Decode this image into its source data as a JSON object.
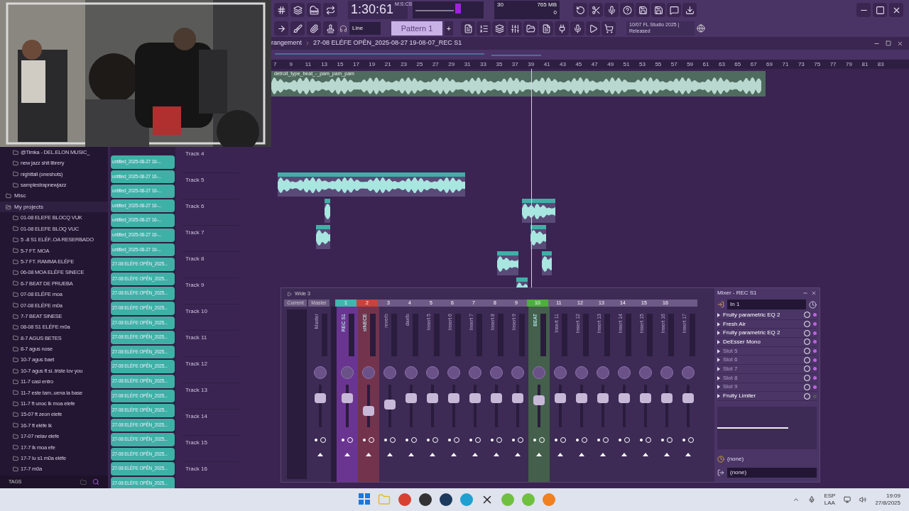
{
  "toolbar": {
    "time": "1:30:61",
    "time_unit": "M:S:CS",
    "cpu": "30",
    "memory": "765 MB",
    "voices": "0",
    "snap": "Line",
    "pattern": "Pattern 1",
    "pattern_add": "+",
    "news": "10/07  FL Studio 2025 | Released"
  },
  "breadcrumb": [
    "rangement",
    "27-08 ELÉFE OPĚN_2025-08-27 19-08-07_REC S1"
  ],
  "ruler": [
    "7",
    "9",
    "11",
    "13",
    "15",
    "17",
    "19",
    "21",
    "23",
    "25",
    "27",
    "29",
    "31",
    "33",
    "35",
    "37",
    "39",
    "41",
    "43",
    "45",
    "47",
    "49",
    "51",
    "53",
    "55",
    "57",
    "59",
    "61",
    "63",
    "65",
    "67",
    "69",
    "71",
    "73",
    "75",
    "77",
    "79",
    "81",
    "83"
  ],
  "top_clip": {
    "label": "detroit_type_beat_-_pam_pam_pam"
  },
  "sidebar": {
    "continued_children": [
      "@Timka - DEL.ELON MUSIC_",
      "new jazz shit librery",
      "nightfall (oneshots)",
      "samplestrapnewjazz"
    ],
    "items": [
      {
        "label": "Misc",
        "expanded": false,
        "selected": false
      },
      {
        "label": "My projects",
        "expanded": true,
        "selected": true,
        "children": [
          "01-08 ELEFE BLOCQ VUK",
          "01-08 ELEFE BLOQ VUC",
          "5 -8 S1 ELÉF..OA RESERBADO",
          "5-7 FT. MOA",
          "5-7 FT. RAMMA ELÉFE",
          "06-08 MOA ELÉFE SINECE",
          "6-7 BEAT DE PRUEBA",
          "07-08  ELÉFE moa",
          "07-08 ELÉFE m0a",
          "7-7 BEAT SINESE",
          "08-08 S1 ELÉFE m0a",
          "8-7 AGUS BETES",
          "8-7 agus nose",
          "10-7 agus baet",
          "10-7 agus ft si..triste lov you",
          "11-7 casi entro",
          "11-7 este tam..uena la base",
          "11-7 ft unoc lk moa elefe",
          "15-07 ft zeon elefe",
          "16-7 ft eléfe lk",
          "17-07 nelav elefe",
          "17-7 lk moa efe",
          "17-7 lu s1 m0a eléfe",
          "17-7 m0a"
        ]
      }
    ],
    "tags_label": "TAGS"
  },
  "clips": [
    "untitled_2025-08-27 16-...",
    "untitled_2025-08-27 16-...",
    "untitled_2025-08-27 16-...",
    "untitled_2025-08-27 16-...",
    "untitled_2025-08-27 16-...",
    "untitled_2025-08-27 16-...",
    "untitled_2025-08-27 16-...",
    "27-08 ELÉFE OPĚN_2025...",
    "27-08 ELÉFE OPĚN_2025...",
    "27-08 ELÉFE OPĚN_2025...",
    "27-08 ELÉFE OPĚN_2025...",
    "27-08 ELÉFE OPĚN_2025...",
    "27-08 ELÉFE OPĚN_2025...",
    "27-08 ELÉFE OPĚN_2025...",
    "27-08 ELÉFE OPĚN_2025...",
    "27-08 ELÉFE OPĚN_2025...",
    "27-08 ELÉFE OPĚN_2025...",
    "27-08 ELÉFE OPĚN_2025...",
    "27-08 ELÉFE OPĚN_2025...",
    "27-08 ELÉFE OPĚN_2025...",
    "27-08 ELÉFE OPĚN_2025...",
    "27-08 ELÉFE OPĚN_2025...",
    "27-08 ELÉFE OPĚN_2025..."
  ],
  "tracks": [
    "Track 4",
    "Track 5",
    "Track 6",
    "Track 7",
    "Track 8",
    "Track 9",
    "Track 10",
    "Track 11",
    "Track 12",
    "Track 13",
    "Track 14",
    "Track 15",
    "Track 16"
  ],
  "mixer": {
    "preset": "Wide 3",
    "current_tab": "Current",
    "master": {
      "tab": "Master",
      "name": "Master",
      "level": 0.75
    },
    "inserts": [
      {
        "number": "1",
        "name": "REC S1",
        "color": "#3fb6ae",
        "selected": true,
        "highlighted": false,
        "level": 0.75
      },
      {
        "number": "2",
        "name": "sINECE",
        "color": "#c8423f",
        "selected": false,
        "highlighted": true,
        "level": 0.35
      },
      {
        "number": "3",
        "name": "reverb",
        "color": "#6e5a86",
        "selected": false,
        "highlighted": false,
        "level": 0.55
      },
      {
        "number": "4",
        "name": "daefx",
        "color": "#6e5a86",
        "selected": false,
        "highlighted": false,
        "level": 0.75
      },
      {
        "number": "5",
        "name": "Insert 5",
        "color": "#6e5a86",
        "selected": false,
        "highlighted": false,
        "level": 0.75
      },
      {
        "number": "6",
        "name": "Insert 6",
        "color": "#6e5a86",
        "selected": false,
        "highlighted": false,
        "level": 0.75
      },
      {
        "number": "7",
        "name": "Insert 7",
        "color": "#6e5a86",
        "selected": false,
        "highlighted": false,
        "level": 0.75
      },
      {
        "number": "8",
        "name": "Insert 8",
        "color": "#6e5a86",
        "selected": false,
        "highlighted": false,
        "level": 0.75
      },
      {
        "number": "9",
        "name": "Insert 9",
        "color": "#6e5a86",
        "selected": false,
        "highlighted": false,
        "level": 0.75
      },
      {
        "number": "10",
        "name": "BEAT",
        "color": "#4fae3f",
        "selected": false,
        "highlighted": true,
        "level": 0.68
      },
      {
        "number": "11",
        "name": "Insert 11",
        "color": "#6e5a86",
        "selected": false,
        "highlighted": false,
        "level": 0.75
      },
      {
        "number": "12",
        "name": "Insert 12",
        "color": "#6e5a86",
        "selected": false,
        "highlighted": false,
        "level": 0.75
      },
      {
        "number": "13",
        "name": "Insert 13",
        "color": "#6e5a86",
        "selected": false,
        "highlighted": false,
        "level": 0.75
      },
      {
        "number": "14",
        "name": "Insert 14",
        "color": "#6e5a86",
        "selected": false,
        "highlighted": false,
        "level": 0.75
      },
      {
        "number": "15",
        "name": "Insert 15",
        "color": "#6e5a86",
        "selected": false,
        "highlighted": false,
        "level": 0.75
      },
      {
        "number": "16",
        "name": "Insert 16",
        "color": "#6e5a86",
        "selected": false,
        "highlighted": false,
        "level": 0.75
      },
      {
        "name": "Insert 17",
        "color": "#6e5a86",
        "selected": false,
        "highlighted": false,
        "level": 0.75
      }
    ]
  },
  "fx_panel": {
    "title": "Mixer - REC S1",
    "input": "In 1",
    "slots": [
      {
        "name": "Fruity parametric EQ 2",
        "empty": false,
        "enabled": true
      },
      {
        "name": "Fresh Air",
        "empty": false,
        "enabled": true
      },
      {
        "name": "Fruity parametric EQ 2",
        "empty": false,
        "enabled": true
      },
      {
        "name": "DeEsser Mono",
        "empty": false,
        "enabled": true
      },
      {
        "name": "Slot 5",
        "empty": true,
        "enabled": true
      },
      {
        "name": "Slot 6",
        "empty": true,
        "enabled": true
      },
      {
        "name": "Slot 7",
        "empty": true,
        "enabled": true
      },
      {
        "name": "Slot 8",
        "empty": true,
        "enabled": true
      },
      {
        "name": "Slot 9",
        "empty": true,
        "enabled": true
      },
      {
        "name": "Fruity Limiter",
        "empty": false,
        "enabled": false
      }
    ],
    "send": "(none)",
    "output": "(none)"
  },
  "taskbar": {
    "language": "ESP",
    "layout": "LAA",
    "time": "19:09",
    "date": "27/8/2025"
  }
}
